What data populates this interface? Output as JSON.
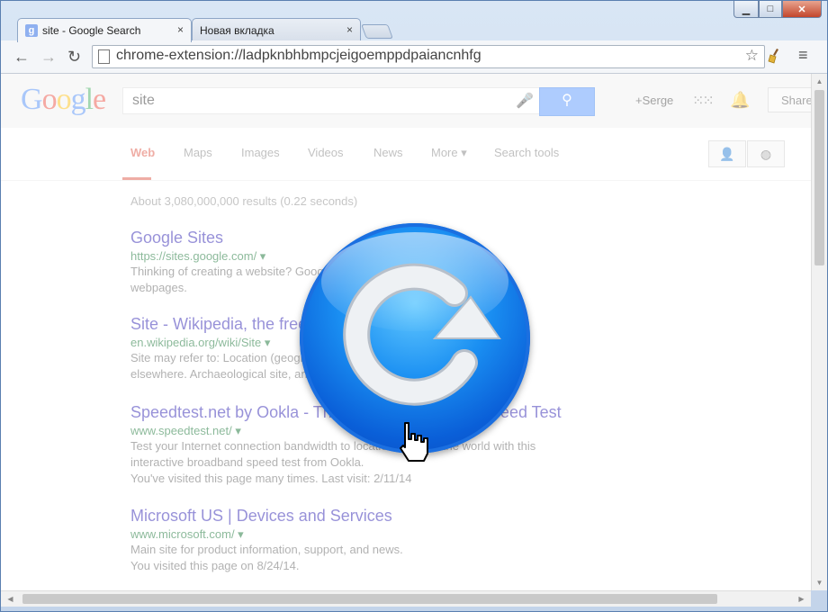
{
  "window": {
    "minimize_glyph": "▁",
    "maximize_glyph": "□",
    "close_glyph": "✕"
  },
  "tabs": [
    {
      "label": "site - Google Search",
      "favicon": "g",
      "close": "×"
    },
    {
      "label": "Новая вкладка",
      "close": "×"
    }
  ],
  "toolbar": {
    "back": "←",
    "forward": "→",
    "reload": "↻",
    "url": "chrome-extension://ladpknbhbmpcjeigoemppdpaiancnhfg",
    "star": "☆",
    "extension_icon": "broom-icon",
    "menu": "≡"
  },
  "google": {
    "logo": [
      "G",
      "o",
      "o",
      "g",
      "l",
      "e"
    ],
    "logo_colors": [
      "#4285f4",
      "#ea4335",
      "#fbbc05",
      "#4285f4",
      "#34a853",
      "#ea4335"
    ],
    "query": "site",
    "user": "+Serge",
    "share": "Share",
    "nav_tabs": [
      "Web",
      "Maps",
      "Images",
      "Videos",
      "News",
      "More ▾",
      "Search tools"
    ],
    "stats": "About 3,080,000,000 results (0.22 seconds)",
    "results": [
      {
        "title": "Google Sites",
        "url": "https://sites.google.com/ ▾",
        "snippet": [
          "Thinking of creating a website? Google Sites ... to create and share",
          "webpages."
        ]
      },
      {
        "title": "Site - Wikipedia, the free encyclopedia",
        "url": "en.wikipedia.org/wiki/Site ▾",
        "snippet": [
          "Site may refer to: Location (geography), a place or location ... or",
          "elsewhere. Archaeological site, an area in which ... evidence ..."
        ]
      },
      {
        "title": "Speedtest.net by Ookla - The Global Broadband Speed Test",
        "url": "www.speedtest.net/ ▾",
        "snippet": [
          "Test your Internet connection bandwidth to locations around the world with this",
          "interactive broadband speed test from Ookla.",
          "You've visited this page many times. Last visit: 2/11/14"
        ]
      },
      {
        "title": "Microsoft US | Devices and Services",
        "url": "www.microsoft.com/ ▾",
        "snippet": [
          "Main site for product information, support, and news.",
          "You visited this page on 8/24/14."
        ]
      }
    ]
  },
  "overlay": {
    "icon": "reload-icon",
    "cursor": "hand-pointer-icon",
    "colors": {
      "ring": "#0746b8",
      "core": "#1a8ff2",
      "arrow": "#e9ecf0"
    }
  }
}
